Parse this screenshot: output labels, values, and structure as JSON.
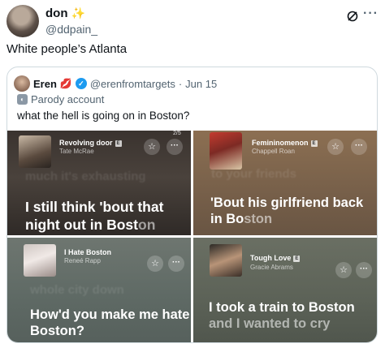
{
  "post": {
    "display_name": "don",
    "handle": "@ddpain_",
    "text": "White people’s Atlanta"
  },
  "quote": {
    "display_name": "Eren",
    "handle": "@erenfromtargets",
    "separator": "·",
    "date": "Jun 15",
    "parody_label": "Parody account",
    "text": "what the hell is going on in Boston?",
    "page_count": "2/5"
  },
  "cards": [
    {
      "title": "Revolving door",
      "artist": "Tate McRae",
      "faded_lyric": "much it's exhausting",
      "lyric_main": "I still think 'bout that night out in Bost",
      "lyric_dim": "on"
    },
    {
      "title": "Femininomenon",
      "artist": "Chappell Roan",
      "faded_lyric": "to your friends",
      "lyric_main": "'Bout his girlfriend back in Bo",
      "lyric_dim": "ston"
    },
    {
      "title": "I Hate Boston",
      "artist": "Reneé Rapp",
      "faded_lyric": "whole city down",
      "lyric_main": "How'd you make me hate Boston?",
      "lyric_dim": ""
    },
    {
      "title": "Tough Love",
      "artist": "Gracie Abrams",
      "faded_lyric": "",
      "lyric_main": "I took a train to Boston ",
      "lyric_dim": "and I wanted to cry"
    }
  ],
  "icons": {
    "sparkle": "✨",
    "lips": "💋",
    "explicit": "E",
    "star": "☆",
    "more": "···",
    "mask": "🎭"
  },
  "colors": {
    "verified_blue": "#1d9bf0",
    "secondary_text": "#536471",
    "border": "#cfd9de"
  }
}
